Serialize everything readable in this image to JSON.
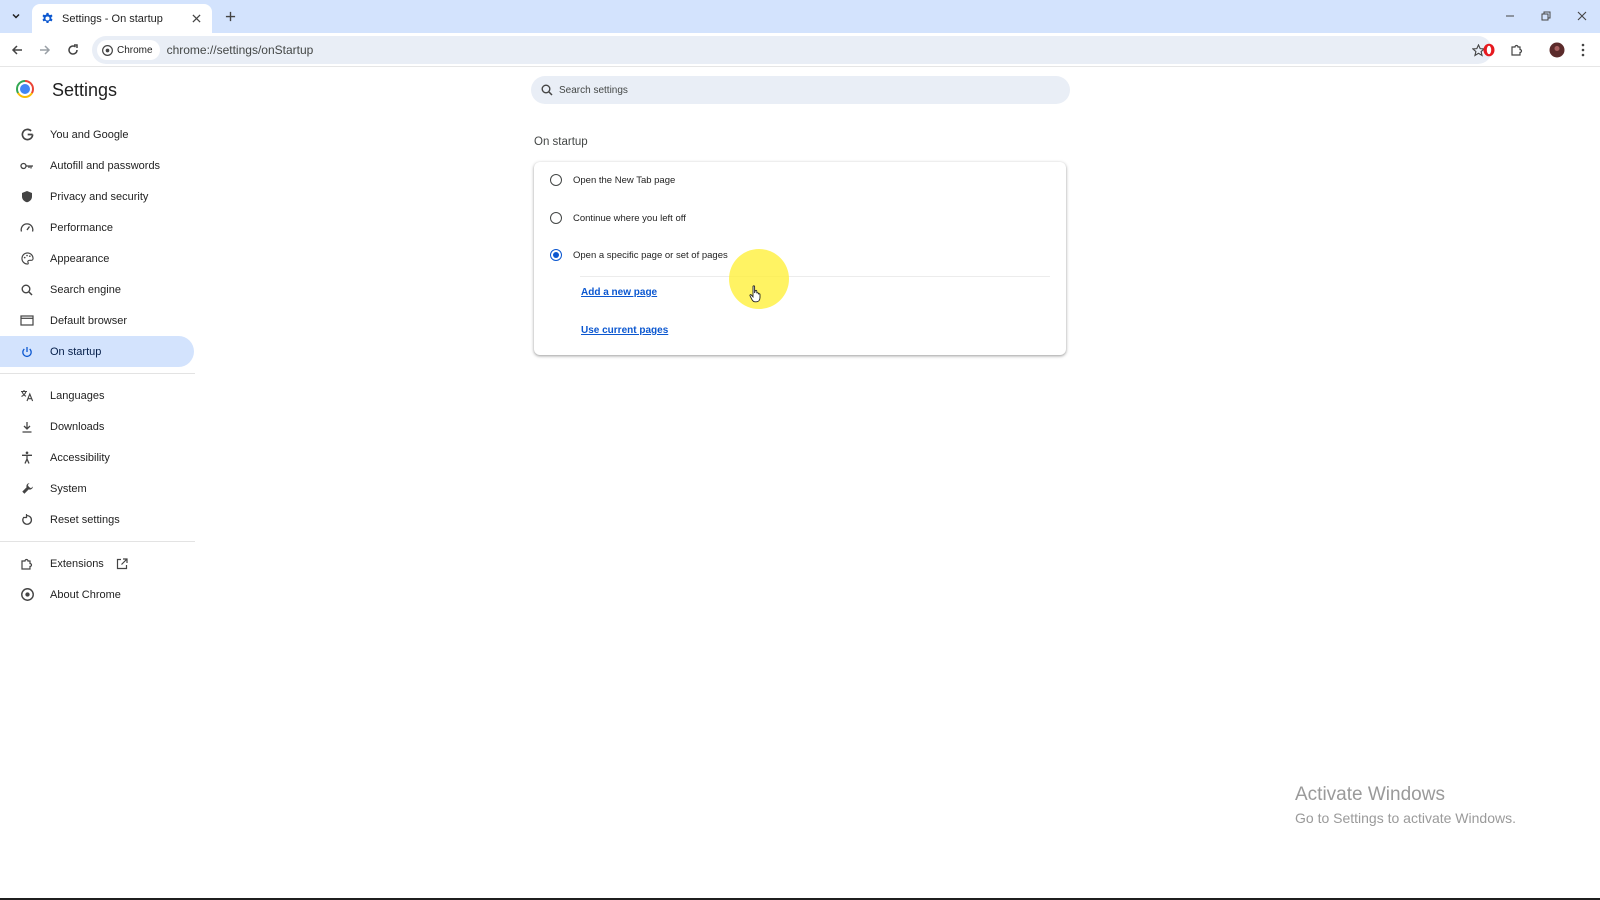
{
  "browser": {
    "tab_title": "Settings - On startup",
    "chip_label": "Chrome",
    "url": "chrome://settings/onStartup"
  },
  "settings": {
    "title": "Settings",
    "search_placeholder": "Search settings"
  },
  "sidebar": {
    "items": [
      {
        "label": "You and Google",
        "icon": "google-g-icon"
      },
      {
        "label": "Autofill and passwords",
        "icon": "key-icon"
      },
      {
        "label": "Privacy and security",
        "icon": "shield-icon"
      },
      {
        "label": "Performance",
        "icon": "speedometer-icon"
      },
      {
        "label": "Appearance",
        "icon": "palette-icon"
      },
      {
        "label": "Search engine",
        "icon": "search-icon"
      },
      {
        "label": "Default browser",
        "icon": "browser-window-icon"
      },
      {
        "label": "On startup",
        "icon": "power-icon",
        "active": true
      },
      {
        "label": "Languages",
        "icon": "translate-icon"
      },
      {
        "label": "Downloads",
        "icon": "download-icon"
      },
      {
        "label": "Accessibility",
        "icon": "accessibility-icon"
      },
      {
        "label": "System",
        "icon": "wrench-icon"
      },
      {
        "label": "Reset settings",
        "icon": "reset-icon"
      },
      {
        "label": "Extensions",
        "icon": "puzzle-icon"
      },
      {
        "label": "About Chrome",
        "icon": "chrome-icon"
      }
    ]
  },
  "startup": {
    "section_title": "On startup",
    "options": [
      {
        "label": "Open the New Tab page",
        "checked": false
      },
      {
        "label": "Continue where you left off",
        "checked": false
      },
      {
        "label": "Open a specific page or set of pages",
        "checked": true
      }
    ],
    "add_page_link": "Add a new page",
    "use_current_link": "Use current pages"
  },
  "watermark": {
    "title": "Activate Windows",
    "subtitle": "Go to Settings to activate Windows."
  },
  "colors": {
    "accent": "#0b57d0",
    "active_nav_bg": "#d3e3fd",
    "tabstrip_bg": "#d3e3fd",
    "omnibox_bg": "#e9eef6",
    "cursor_highlight": "#fff03c"
  }
}
